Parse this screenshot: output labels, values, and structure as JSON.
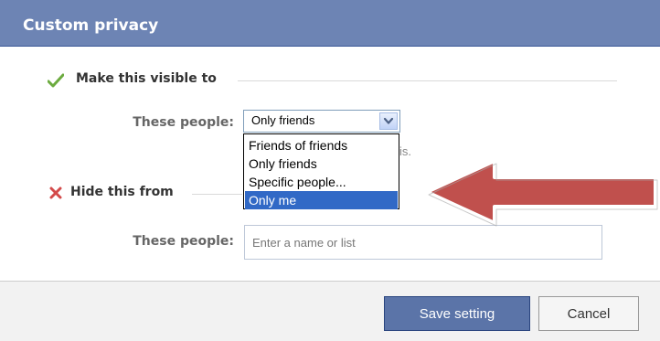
{
  "dialog": {
    "title": "Custom privacy"
  },
  "visible_section": {
    "heading": "Make this visible to",
    "icon": "check-icon",
    "label": "These people:",
    "selected_value": "Only friends",
    "dropdown_options": [
      "Friends of friends",
      "Only friends",
      "Specific people...",
      "Only me"
    ],
    "highlighted_option": "Only me",
    "partially_hidden_text": "is."
  },
  "hide_section": {
    "heading": "Hide this from",
    "icon": "x-icon",
    "label": "These people:",
    "input_placeholder": "Enter a name or list",
    "input_value": ""
  },
  "footer": {
    "save_label": "Save setting",
    "cancel_label": "Cancel"
  },
  "annotation": {
    "icon": "red-arrow-icon"
  },
  "colors": {
    "header_bg": "#6d84b4",
    "selected_option_bg": "#3169c6",
    "save_button_bg": "#5b74a8",
    "arrow": "#c0504d"
  }
}
